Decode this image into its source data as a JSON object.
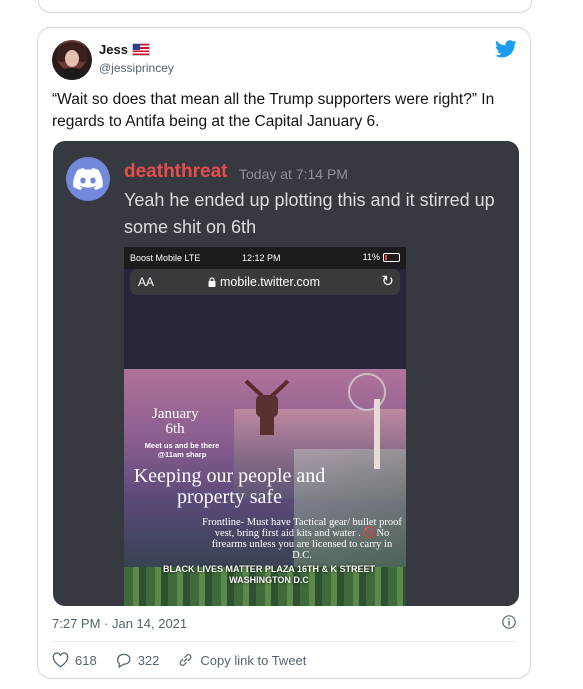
{
  "tweet": {
    "author_name": "Jess",
    "author_flag": "🇺🇸",
    "author_handle": "@jessiprincey",
    "text": "“Wait so does that mean all the Trump supporters were right?” In regards to Antifa being at the Capital January 6.",
    "timestamp": "7:27 PM · Jan 14, 2021",
    "likes": "618",
    "replies": "322",
    "copy_link_label": "Copy link to Tweet"
  },
  "discord": {
    "username": "deaththreat",
    "time": "Today at 7:14 PM",
    "message": "Yeah he ended up plotting this and it stirred up some shit on 6th"
  },
  "phone": {
    "carrier": "Boost Mobile  LTE",
    "clock": "12:12 PM",
    "battery": "11%",
    "aa": "AA",
    "url": "mobile.twitter.com"
  },
  "poster": {
    "date": "January 6th",
    "meet": "Meet us and be there @11am sharp",
    "headline": "Keeping our people and property safe",
    "frontline": "Frontline- Must have Tactical gear/ bullet proof vest, bring first aid kits and water . 🚫No firearms unless you are licensed to carry in D.C.",
    "location": "BLACK LIVES MATTER PLAZA 16TH & K STREET WASHINGTON D.C"
  },
  "colors": {
    "twitter_blue": "#1d9bf0",
    "discord_bg": "#36393f",
    "discord_blurple": "#7289da",
    "username_red": "#e84d4d"
  }
}
